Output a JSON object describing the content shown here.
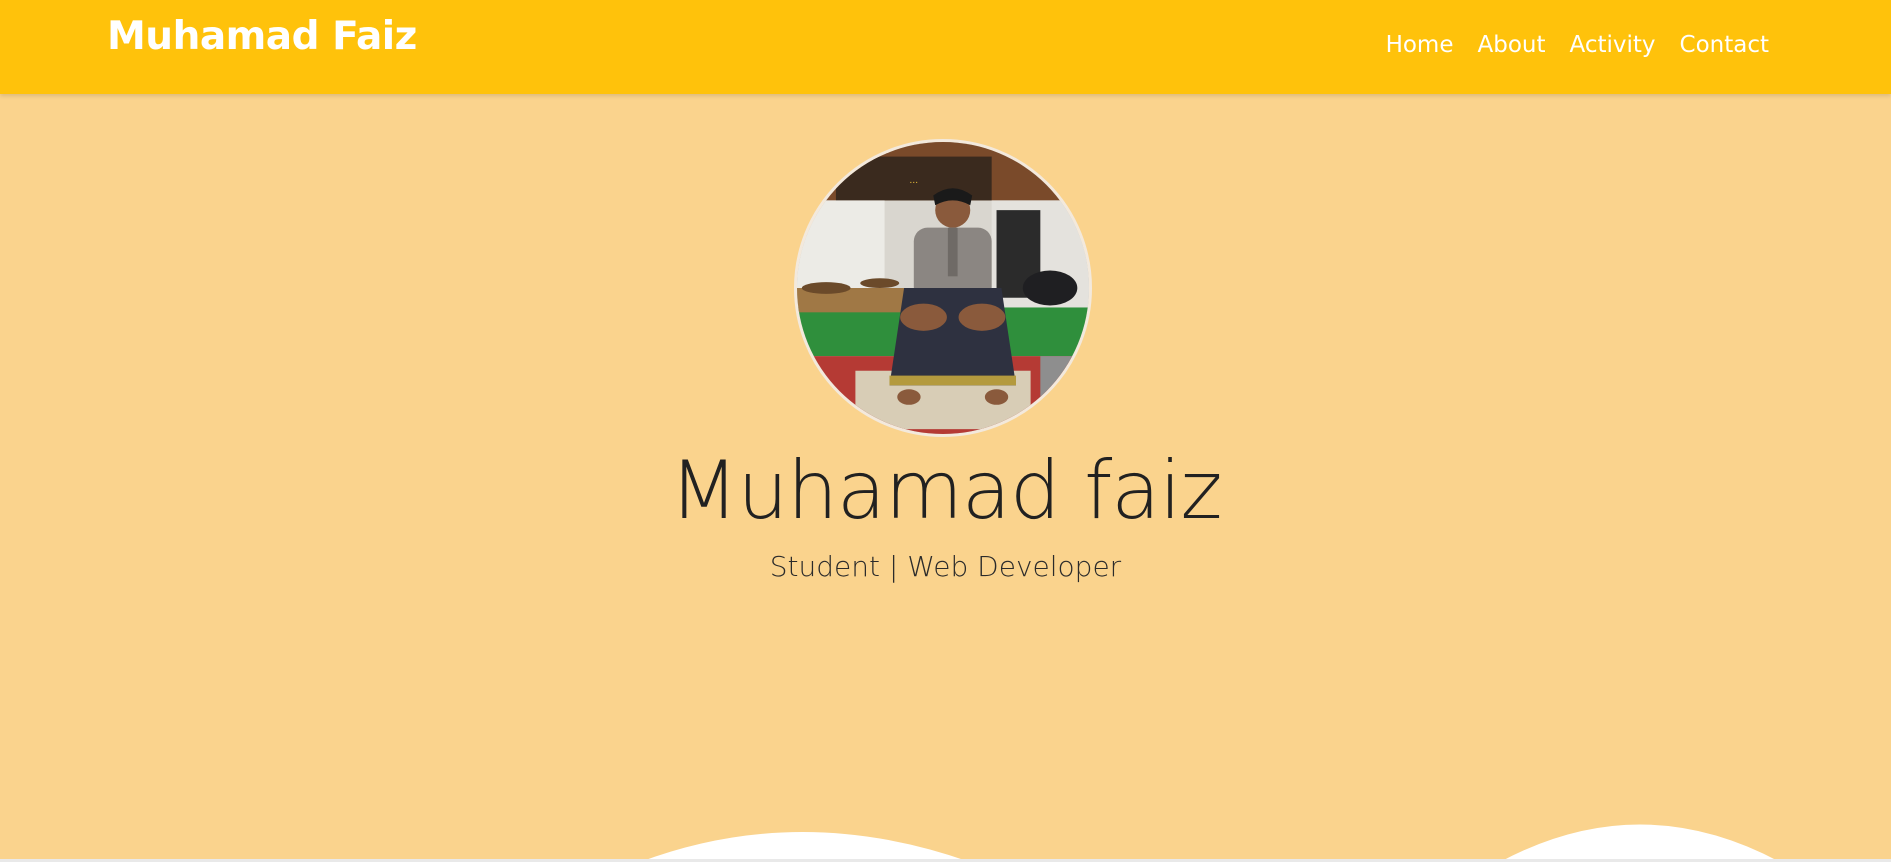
{
  "navbar": {
    "brand": "Muhamad Faiz",
    "links": [
      {
        "label": "Home"
      },
      {
        "label": "About"
      },
      {
        "label": "Activity"
      },
      {
        "label": "Contact"
      }
    ]
  },
  "hero": {
    "name": "Muhamad faiz",
    "subtitle": "Student | Web Developer",
    "avatar": "profile-photo"
  },
  "colors": {
    "navbar": "#ffc20b",
    "background": "#fad38d",
    "wave": "#ffffff",
    "text": "#212121"
  }
}
